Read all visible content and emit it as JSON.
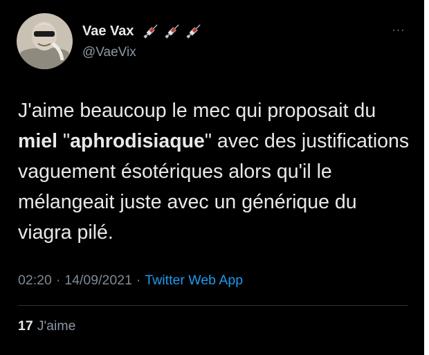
{
  "author": {
    "display_name": "Vae Vax",
    "handle": "@VaeVix",
    "name_emoji": [
      "syringe-icon",
      "syringe-icon",
      "syringe-icon"
    ]
  },
  "menu": {
    "more_label": "···"
  },
  "tweet": {
    "text_part1": "J'aime beaucoup le mec qui proposait du ",
    "text_bold1": "miel",
    "text_part2": " \"",
    "text_bold2": "aphrodisiaque",
    "text_part3": "\" avec des justifications vaguement ésotériques alors qu'il le mélangeait juste avec un générique du viagra pilé."
  },
  "meta": {
    "time": "02:20",
    "separator": "·",
    "date": "14/09/2021",
    "source": "Twitter Web App"
  },
  "stats": {
    "likes_count": "17",
    "likes_label": "J'aime"
  },
  "colors": {
    "background": "#000000",
    "text": "#e7e9ea",
    "secondary": "#8b98a5",
    "link": "#1d9bf0",
    "divider": "#2f3336"
  }
}
